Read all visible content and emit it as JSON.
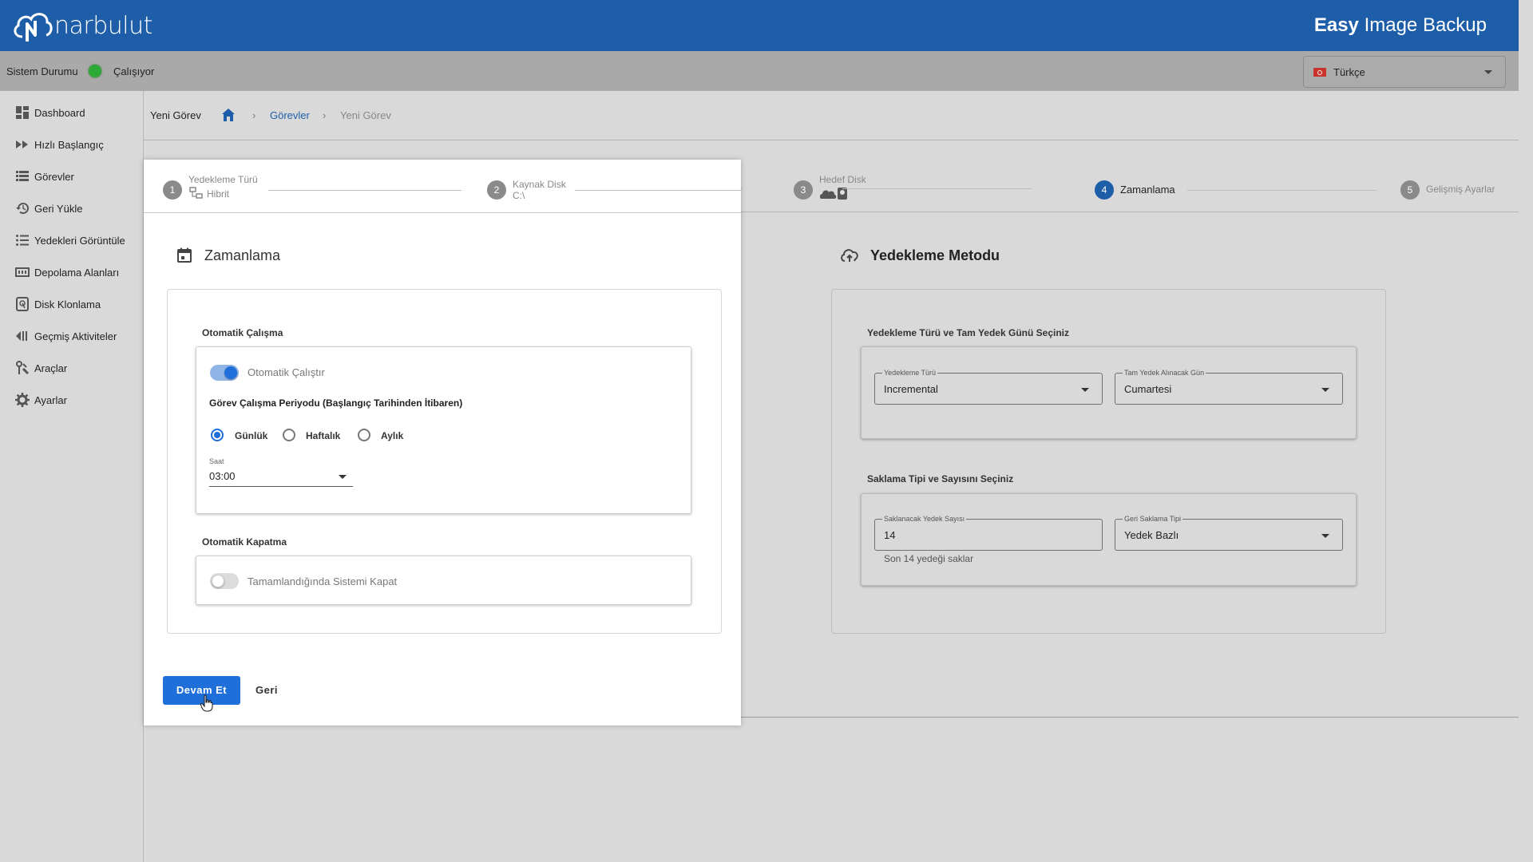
{
  "app": {
    "logo_text": "narbulut",
    "title_bold": "Easy",
    "title_rest": " Image Backup"
  },
  "status": {
    "label": "Sistem Durumu",
    "value": "Çalışıyor",
    "color": "#2da935"
  },
  "language": {
    "selected": "Türkçe"
  },
  "sidebar": {
    "items": [
      {
        "label": "Dashboard",
        "icon": "dashboard-icon"
      },
      {
        "label": "Hızlı Başlangıç",
        "icon": "fast-forward-icon"
      },
      {
        "label": "Görevler",
        "icon": "list-icon"
      },
      {
        "label": "Geri Yükle",
        "icon": "restore-icon"
      },
      {
        "label": "Yedekleri Görüntüle",
        "icon": "bullet-list-icon"
      },
      {
        "label": "Depolama Alanları",
        "icon": "storage-icon"
      },
      {
        "label": "Disk Klonlama",
        "icon": "disk-icon"
      },
      {
        "label": "Geçmiş Aktiviteler",
        "icon": "history-icon"
      },
      {
        "label": "Araçlar",
        "icon": "tools-icon"
      },
      {
        "label": "Ayarlar",
        "icon": "gear-icon"
      }
    ]
  },
  "breadcrumb": {
    "title": "Yeni Görev",
    "link": "Görevler",
    "current": "Yeni Görev",
    "sep": "›"
  },
  "stepper": {
    "steps": [
      {
        "num": "1",
        "title": "Yedekleme Türü",
        "sub": "Hibrit"
      },
      {
        "num": "2",
        "title": "Kaynak Disk",
        "sub": "C:\\"
      },
      {
        "num": "3",
        "title": "Hedef Disk",
        "sub": ""
      },
      {
        "num": "4",
        "title": "Zamanlama",
        "sub": ""
      },
      {
        "num": "5",
        "title": "Gelişmiş Ayarlar",
        "sub": ""
      }
    ],
    "active": 4
  },
  "schedule": {
    "title": "Zamanlama",
    "auto_run_section": "Otomatik Çalışma",
    "auto_run_label": "Otomatik Çalıştır",
    "auto_run_on": true,
    "period_label": "Görev Çalışma Periyodu (Başlangıç Tarihinden İtibaren)",
    "periods": [
      "Günlük",
      "Haftalık",
      "Aylık"
    ],
    "selected_period": "Günlük",
    "time_label": "Saat",
    "time_value": "03:00",
    "shutdown_section": "Otomatik Kapatma",
    "shutdown_label": "Tamamlandığında Sistemi Kapat",
    "shutdown_on": false
  },
  "method": {
    "title": "Yedekleme Metodu",
    "type_section": "Yedekleme Türü ve Tam Yedek Günü Seçiniz",
    "type_label": "Yedekleme Türü",
    "type_value": "Incremental",
    "full_day_label": "Tam Yedek Alınacak Gün",
    "full_day_value": "Cumartesi",
    "retention_section": "Saklama Tipi ve Sayısını Seçiniz",
    "count_label": "Saklanacak Yedek Sayısı",
    "count_value": "14",
    "count_hint": "Son 14 yedeği saklar",
    "retention_type_label": "Geri Saklama Tipi",
    "retention_type_value": "Yedek Bazlı"
  },
  "actions": {
    "next": "Devam Et",
    "back": "Geri"
  }
}
